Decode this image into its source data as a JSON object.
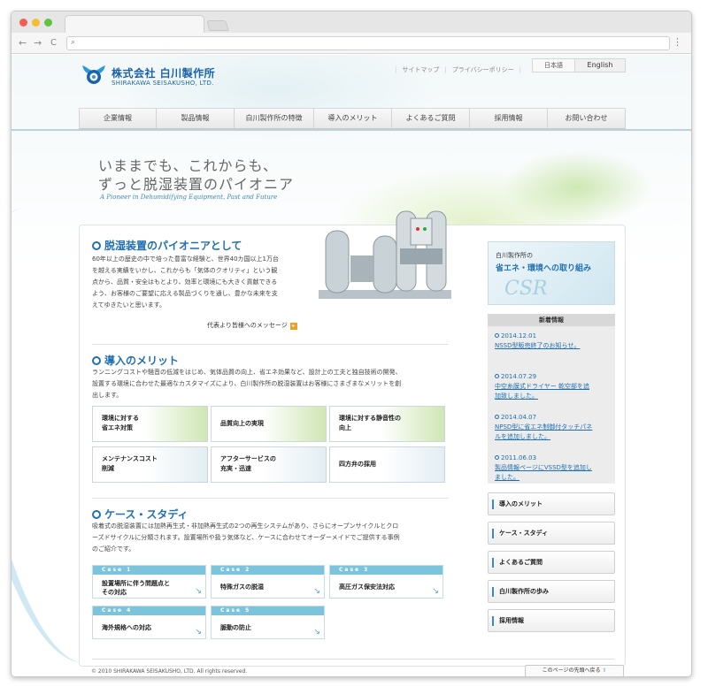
{
  "browser": {
    "nav_back": "←",
    "nav_forward": "→",
    "reload": "C",
    "search_glyph": "⌕",
    "menu": "⋮",
    "url_value": ""
  },
  "header": {
    "logo_jp": "株式会社 白川製作所",
    "logo_en": "SHIRAKAWA SEISAKUSHO, LTD.",
    "util_links": [
      "サイトマップ",
      "プライバシーポリシー"
    ],
    "lang_jp": "日本語",
    "lang_en": "English"
  },
  "gnav": [
    {
      "label": "企業情報",
      "w": 88
    },
    {
      "label": "製品情報",
      "w": 88
    },
    {
      "label": "白川製作所の特徴",
      "w": 90
    },
    {
      "label": "導入のメリット",
      "w": 88
    },
    {
      "label": "よくあるご質問",
      "w": 88
    },
    {
      "label": "採用情報",
      "w": 88
    },
    {
      "label": "お問い合わせ",
      "w": 88
    }
  ],
  "hero": {
    "line1": "いままでも、これからも、",
    "line2": "ずっと脱湿装置のパイオニア",
    "en": "A Pioneer in Dehumidifying Equipment, Past and Future"
  },
  "intro": {
    "title": "脱湿装置のパイオニアとして",
    "lines": [
      "60年以上の歴史の中で培った豊富な経験と、世界40カ国以上1万台",
      "を越える実績をいかし、これからも「気体のクオリティ」という観",
      "点から、品質・安全はもとより、効率と環境にも大きく貢献できる",
      "よう、お客様のご要望に応える製品づくりを通し、豊かな未来を支",
      "えてゆきたいと思います。"
    ],
    "message_link": "代表より皆様へのメッセージ"
  },
  "merit": {
    "title": "導入のメリット",
    "lines": [
      "ランニングコストや騒音の低減をはじめ、気体品質の向上、省エネ効果など、設計上の工夫と独自技術の開発、",
      "設置する環境に合わせた最適なカスタマイズにより、白川製作所の脱湿装置はお客様にさまざまなメリットを創",
      "出します。"
    ],
    "tiles": [
      {
        "l1": "環境に対する",
        "l2": "省エネ対策"
      },
      {
        "l1": "品質向上の実現",
        "l2": ""
      },
      {
        "l1": "環境に対する静音性の",
        "l2": "向上"
      },
      {
        "l1": "メンテナンスコスト",
        "l2": "削減"
      },
      {
        "l1": "アフターサービスの",
        "l2": "充実・迅速"
      },
      {
        "l1": "四方弁の採用",
        "l2": ""
      }
    ]
  },
  "cases": {
    "title": "ケース・スタディ",
    "lines": [
      "吸着式の脱湿装置には加熱再生式・非加熱再生式の2つの再生システムがあり、さらにオープンサイクルとクロ",
      "ーズドサイクルに分類されます。設置場所や扱う気体など、ケースに合わせてオーダーメイドでご提供する事例",
      "のご紹介です。"
    ],
    "tiles": [
      {
        "hdr": "Case 1",
        "l1": "設置場所に伴う問題点と",
        "l2": "その対応"
      },
      {
        "hdr": "Case 2",
        "l1": "特殊ガスの脱湿",
        "l2": ""
      },
      {
        "hdr": "Case 3",
        "l1": "高圧ガス保安法対応",
        "l2": ""
      },
      {
        "hdr": "Case 4",
        "l1": "海外規格への対応",
        "l2": ""
      },
      {
        "hdr": "Case 5",
        "l1": "脈動の防止",
        "l2": ""
      }
    ]
  },
  "sidebar": {
    "csr_small": "白川製作所の",
    "csr_big": "省エネ・環境への取り組み",
    "csr_logo": "CSR",
    "news_title": "新着情報",
    "news": [
      {
        "date": "2014.12.01",
        "t1": "NSSD型販売終了のお知らせ。",
        "t2": ""
      },
      {
        "date": "2014.07.29",
        "t1": "中空糸膜式ドライヤー 乾空部を追",
        "t2": "加致しました。"
      },
      {
        "date": "2014.04.07",
        "t1": "NPSD型に省エネ制御付タッチパネ",
        "t2": "ルを追加しました。"
      },
      {
        "date": "2011.06.03",
        "t1": "製品情報ページにVSSD型を追加し",
        "t2": "ました。"
      }
    ],
    "buttons": [
      "導入のメリット",
      "ケース・スタディ",
      "よくあるご質問",
      "白川製作所の歩み",
      "採用情報"
    ]
  },
  "footer": {
    "copyright": "© 2010 SHIRAKAWA SEISAKUSHO, LTD. All rights reserved.",
    "top_link": "このページの先頭へ戻る"
  },
  "colors": {
    "accent": "#1f6fb2",
    "case_header": "#7cc3dc"
  }
}
